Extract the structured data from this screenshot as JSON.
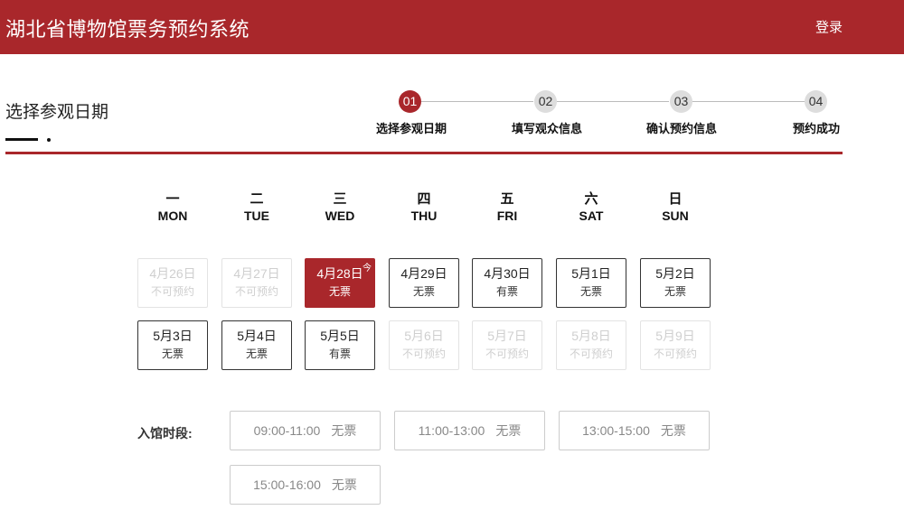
{
  "header": {
    "title": "湖北省博物馆票务预约系统",
    "login": "登录"
  },
  "section": {
    "title": "选择参观日期"
  },
  "steps": [
    {
      "num": "01",
      "label": "选择参观日期"
    },
    {
      "num": "02",
      "label": "填写观众信息"
    },
    {
      "num": "03",
      "label": "确认预约信息"
    },
    {
      "num": "04",
      "label": "预约成功"
    }
  ],
  "weekdays": [
    {
      "zh": "一",
      "en": "MON"
    },
    {
      "zh": "二",
      "en": "TUE"
    },
    {
      "zh": "三",
      "en": "WED"
    },
    {
      "zh": "四",
      "en": "THU"
    },
    {
      "zh": "五",
      "en": "FRI"
    },
    {
      "zh": "六",
      "en": "SAT"
    },
    {
      "zh": "日",
      "en": "SUN"
    }
  ],
  "days": [
    {
      "date": "4月26日",
      "status": "不可预约",
      "state": "disabled"
    },
    {
      "date": "4月27日",
      "status": "不可预约",
      "state": "disabled"
    },
    {
      "date": "4月28日",
      "status": "无票",
      "state": "selected",
      "badge": "今"
    },
    {
      "date": "4月29日",
      "status": "无票",
      "state": "normal"
    },
    {
      "date": "4月30日",
      "status": "有票",
      "state": "normal"
    },
    {
      "date": "5月1日",
      "status": "无票",
      "state": "normal"
    },
    {
      "date": "5月2日",
      "status": "无票",
      "state": "normal"
    },
    {
      "date": "5月3日",
      "status": "无票",
      "state": "normal"
    },
    {
      "date": "5月4日",
      "status": "无票",
      "state": "normal"
    },
    {
      "date": "5月5日",
      "status": "有票",
      "state": "normal"
    },
    {
      "date": "5月6日",
      "status": "不可预约",
      "state": "disabled"
    },
    {
      "date": "5月7日",
      "status": "不可预约",
      "state": "disabled"
    },
    {
      "date": "5月8日",
      "status": "不可预约",
      "state": "disabled"
    },
    {
      "date": "5月9日",
      "status": "不可预约",
      "state": "disabled"
    }
  ],
  "timeslots": {
    "label": "入馆时段:",
    "slots": [
      {
        "time": "09:00-11:00",
        "status": "无票"
      },
      {
        "time": "11:00-13:00",
        "status": "无票"
      },
      {
        "time": "13:00-15:00",
        "status": "无票"
      },
      {
        "time": "15:00-16:00",
        "status": "无票"
      }
    ]
  },
  "colors": {
    "brand": "#a9272b",
    "inactive_step": "#dddddd",
    "disabled_text": "#cfcfcf"
  }
}
